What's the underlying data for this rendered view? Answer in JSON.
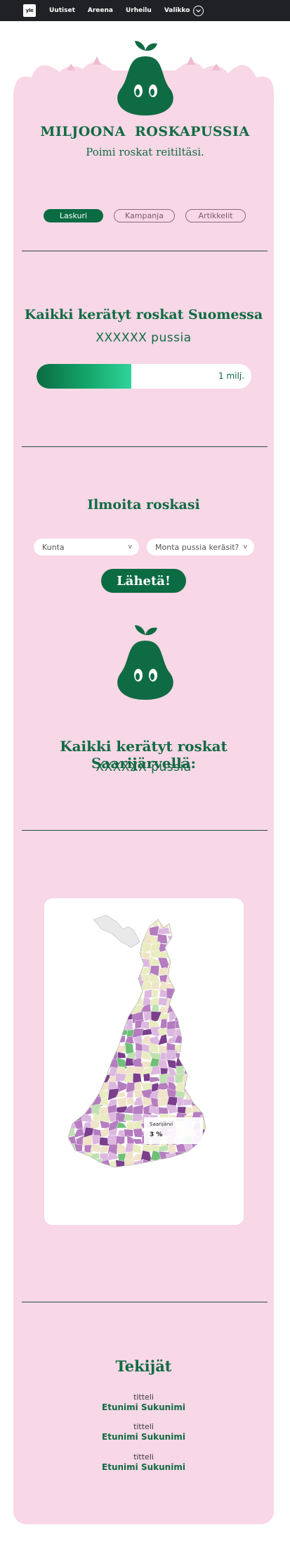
{
  "nav": {
    "logo": "yle",
    "links": [
      "Uutiset",
      "Areena",
      "Urheilu"
    ],
    "menu_label": "Valikko"
  },
  "brand": {
    "title": "MILJOONA ROSKAPUSSIA",
    "subtitle": "Poimi roskat reitiltäsi."
  },
  "tabs": [
    "Laskuri",
    "Kampanja",
    "Artikkelit"
  ],
  "finland_total": {
    "title": "Kaikki kerätyt roskat Suomessa",
    "count": "XXXXXX pussia",
    "progress_label": "1 milj.",
    "progress_fraction": 0.44
  },
  "report": {
    "title": "Ilmoita roskasi",
    "municipality_placeholder": "Kunta",
    "bags_placeholder": "Monta pussia keräsit?",
    "submit_label": "Lähetä!"
  },
  "local_total": {
    "title": "Kaikki kerätyt roskat Saarijärvellä:",
    "count": "XXXXXX pussia"
  },
  "map": {
    "tooltip_name": "Saarijärvi",
    "tooltip_value": "3 %",
    "palette": [
      "#7b3f8c",
      "#b57cc0",
      "#dcb8e0",
      "#efe3c8",
      "#e8ecc0",
      "#bfe0b0",
      "#6fbf78",
      "#2e8a45",
      "#e9e9e9"
    ]
  },
  "credits": {
    "title": "Tekijät",
    "people": [
      {
        "role": "titteli",
        "name": "Etunimi Sukunimi"
      },
      {
        "role": "titteli",
        "name": "Etunimi Sukunimi"
      },
      {
        "role": "titteli",
        "name": "Etunimi Sukunimi"
      }
    ]
  },
  "colors": {
    "brand_green": "#0f6b43",
    "card_pink": "#f8d7e6",
    "nav_bg": "#202124"
  }
}
